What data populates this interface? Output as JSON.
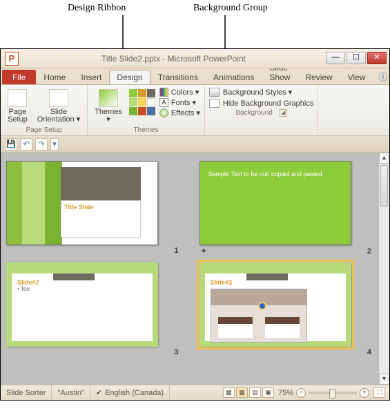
{
  "annotations": {
    "design_ribbon": "Design Ribbon",
    "background_group": "Background Group"
  },
  "window": {
    "title": "Title Slide2.pptx - Microsoft PowerPoint"
  },
  "tabs": {
    "file": "File",
    "home": "Home",
    "insert": "Insert",
    "design": "Design",
    "transitions": "Transitions",
    "animations": "Animations",
    "slide_show": "Slide Show",
    "review": "Review",
    "view": "View"
  },
  "ribbon": {
    "page_setup": {
      "page_setup": "Page\nSetup",
      "orientation": "Slide\nOrientation ▾",
      "group_label": "Page Setup"
    },
    "themes": {
      "themes_btn": "Themes\n▾",
      "colors": "Colors ▾",
      "fonts": "Fonts ▾",
      "effects": "Effects ▾",
      "group_label": "Themes"
    },
    "background": {
      "styles": "Background Styles ▾",
      "hide": "Hide Background Graphics",
      "group_label": "Background"
    }
  },
  "slides": {
    "s1": {
      "title": "Title Slide",
      "num": "1"
    },
    "s2": {
      "text": "Sample Text to be cut/ copied and pasted",
      "num": "2"
    },
    "s3": {
      "title": "Slide#2",
      "bullet": "Too",
      "num": "3"
    },
    "s4": {
      "title": "Slide#3",
      "num": "4"
    }
  },
  "status": {
    "view": "Slide Sorter",
    "theme": "\"Austin\"",
    "lang": "English (Canada)",
    "zoom": "75%"
  },
  "colors": {
    "accent_green": "#8ecb3a",
    "accent_olive": "#b8d97a",
    "file_red": "#c0392b"
  }
}
